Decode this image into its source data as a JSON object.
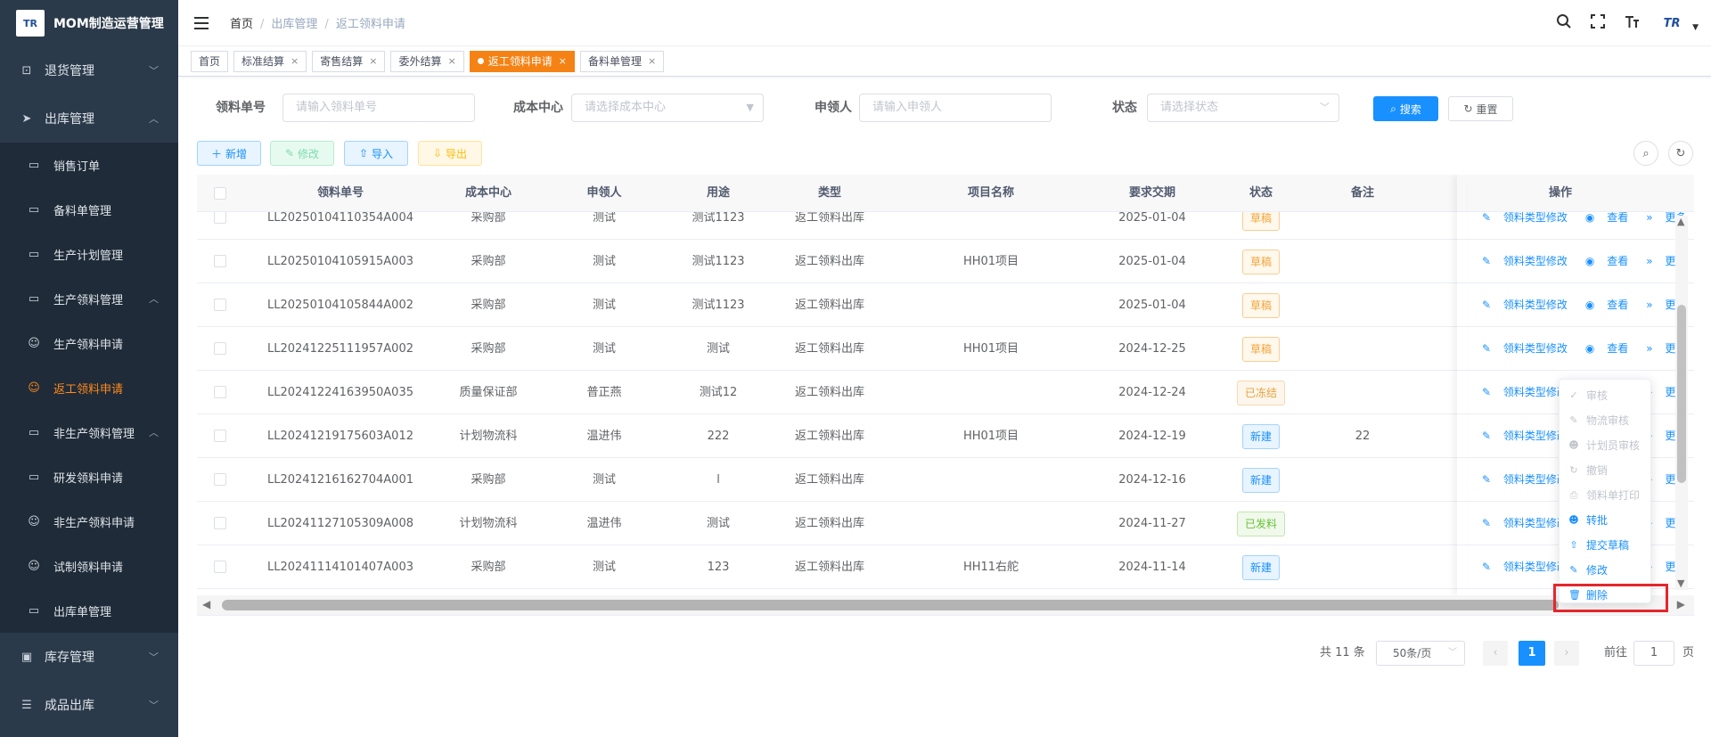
{
  "app": {
    "title": "MOM制造运营管理",
    "logo_text": "TR"
  },
  "sidebar": {
    "top_items": [
      {
        "label": "退货管理",
        "icon": "square-icon"
      }
    ],
    "outbound": {
      "label": "出库管理",
      "icon": "send-icon"
    },
    "sub_items": [
      {
        "label": "销售订单",
        "icon": "book-icon"
      },
      {
        "label": "备料单管理",
        "icon": "book-icon"
      },
      {
        "label": "生产计划管理",
        "icon": "book-icon"
      },
      {
        "label": "生产领料管理",
        "icon": "book-icon"
      },
      {
        "label": "生产领料申请",
        "icon": "user-icon"
      },
      {
        "label": "返工领料申请",
        "icon": "user-icon"
      },
      {
        "label": "非生产领料管理",
        "icon": "book-icon"
      },
      {
        "label": "研发领料申请",
        "icon": "book-icon"
      },
      {
        "label": "非生产领料申请",
        "icon": "user-icon"
      },
      {
        "label": "试制领料申请",
        "icon": "user-icon"
      },
      {
        "label": "出库单管理",
        "icon": "book-icon"
      }
    ],
    "bottom_items": [
      {
        "label": "库存管理",
        "icon": "monitor-icon"
      },
      {
        "label": "成品出库",
        "icon": "list-icon"
      }
    ]
  },
  "header": {
    "breadcrumb": [
      "首页",
      "出库管理",
      "返工领料申请"
    ],
    "logo_text": "TR"
  },
  "tags": [
    {
      "label": "首页",
      "closable": false,
      "active": false
    },
    {
      "label": "标准结算",
      "closable": true,
      "active": false
    },
    {
      "label": "寄售结算",
      "closable": true,
      "active": false
    },
    {
      "label": "委外结算",
      "closable": true,
      "active": false
    },
    {
      "label": "返工领料申请",
      "closable": true,
      "active": true
    },
    {
      "label": "备料单管理",
      "closable": true,
      "active": false
    }
  ],
  "search": {
    "order_no_label": "领料单号",
    "order_no_placeholder": "请输入领料单号",
    "cost_center_label": "成本中心",
    "cost_center_placeholder": "请选择成本中心",
    "applicant_label": "申领人",
    "applicant_placeholder": "请输入申领人",
    "status_label": "状态",
    "status_placeholder": "请选择状态",
    "search_btn": "搜索",
    "reset_btn": "重置"
  },
  "toolbar": {
    "add": "新增",
    "edit": "修改",
    "import": "导入",
    "export": "导出"
  },
  "table": {
    "columns": [
      "领料单号",
      "成本中心",
      "申领人",
      "用途",
      "类型",
      "项目名称",
      "要求交期",
      "状态",
      "备注",
      "操作"
    ],
    "rows": [
      {
        "no": "LL20250104110354A004",
        "center": "采购部",
        "applicant": "测试",
        "usage": "测试1123",
        "type": "返工领料出库",
        "project": "",
        "date": "2025-01-04",
        "status": "草稿",
        "status_kind": "draft",
        "remark": ""
      },
      {
        "no": "LL20250104105915A003",
        "center": "采购部",
        "applicant": "测试",
        "usage": "测试1123",
        "type": "返工领料出库",
        "project": "HH01项目",
        "date": "2025-01-04",
        "status": "草稿",
        "status_kind": "draft",
        "remark": ""
      },
      {
        "no": "LL20250104105844A002",
        "center": "采购部",
        "applicant": "测试",
        "usage": "测试1123",
        "type": "返工领料出库",
        "project": "",
        "date": "2025-01-04",
        "status": "草稿",
        "status_kind": "draft",
        "remark": ""
      },
      {
        "no": "LL20241225111957A002",
        "center": "采购部",
        "applicant": "测试",
        "usage": "测试",
        "type": "返工领料出库",
        "project": "HH01项目",
        "date": "2024-12-25",
        "status": "草稿",
        "status_kind": "draft",
        "remark": ""
      },
      {
        "no": "LL20241224163950A035",
        "center": "质量保证部",
        "applicant": "普正燕",
        "usage": "测试12",
        "type": "返工领料出库",
        "project": "",
        "date": "2024-12-24",
        "status": "已冻结",
        "status_kind": "frozen",
        "remark": ""
      },
      {
        "no": "LL20241219175603A012",
        "center": "计划物流科",
        "applicant": "温进伟",
        "usage": "222",
        "type": "返工领料出库",
        "project": "HH01项目",
        "date": "2024-12-19",
        "status": "新建",
        "status_kind": "new",
        "remark": "22"
      },
      {
        "no": "LL20241216162704A001",
        "center": "采购部",
        "applicant": "测试",
        "usage": "l",
        "type": "返工领料出库",
        "project": "",
        "date": "2024-12-16",
        "status": "新建",
        "status_kind": "new",
        "remark": ""
      },
      {
        "no": "LL20241127105309A008",
        "center": "计划物流科",
        "applicant": "温进伟",
        "usage": "测试",
        "type": "返工领料出库",
        "project": "",
        "date": "2024-11-27",
        "status": "已发料",
        "status_kind": "issued",
        "remark": ""
      },
      {
        "no": "LL20241114101407A003",
        "center": "采购部",
        "applicant": "测试",
        "usage": "123",
        "type": "返工领料出库",
        "project": "HH11右舵",
        "date": "2024-11-14",
        "status": "新建",
        "status_kind": "new",
        "remark": ""
      }
    ],
    "op_edit_type": "领料类型修改",
    "op_view": "查看",
    "op_more": "更多"
  },
  "more_menu": {
    "items": [
      {
        "label": "审核",
        "icon": "check-icon",
        "enabled": false
      },
      {
        "label": "物流审核",
        "icon": "edit-icon",
        "enabled": false
      },
      {
        "label": "计划员审核",
        "icon": "user-icon",
        "enabled": false
      },
      {
        "label": "撤销",
        "icon": "refresh-icon",
        "enabled": false
      },
      {
        "label": "领料单打印",
        "icon": "print-icon",
        "enabled": false
      },
      {
        "label": "转批",
        "icon": "user-icon",
        "enabled": true
      },
      {
        "label": "提交草稿",
        "icon": "upload-icon",
        "enabled": true
      },
      {
        "label": "修改",
        "icon": "edit-icon",
        "enabled": true
      },
      {
        "label": "删除",
        "icon": "trash-icon",
        "enabled": true
      }
    ]
  },
  "pagination": {
    "total": "共 11 条",
    "page_size": "50条/页",
    "current": "1",
    "goto_label": "前往",
    "goto_value": "1",
    "page_suffix": "页"
  },
  "colors": {
    "primary": "#1890ff",
    "sidebar_bg": "#2b3a4a",
    "active_tag": "#f58214",
    "highlight": "#e4262c"
  }
}
